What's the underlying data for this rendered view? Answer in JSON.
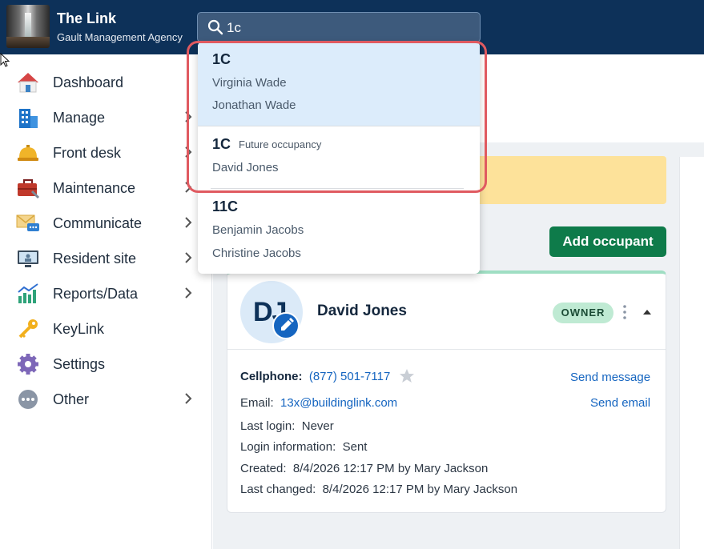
{
  "app": {
    "title": "The Link",
    "subtitle": "Gault Management Agency"
  },
  "search": {
    "value": "1c",
    "icon": "search-icon"
  },
  "sidebar": {
    "items": [
      {
        "label": "Dashboard",
        "icon": "house-icon",
        "has_chevron": false
      },
      {
        "label": "Manage",
        "icon": "building-icon",
        "has_chevron": true
      },
      {
        "label": "Front desk",
        "icon": "service-bell-icon",
        "has_chevron": true
      },
      {
        "label": "Maintenance",
        "icon": "toolbox-icon",
        "has_chevron": true
      },
      {
        "label": "Communicate",
        "icon": "envelope-chat-icon",
        "has_chevron": true
      },
      {
        "label": "Resident site",
        "icon": "monitor-icon",
        "has_chevron": true
      },
      {
        "label": "Reports/Data",
        "icon": "bar-chart-icon",
        "has_chevron": true
      },
      {
        "label": "KeyLink",
        "icon": "key-icon",
        "has_chevron": false
      },
      {
        "label": "Settings",
        "icon": "gear-icon",
        "has_chevron": false
      },
      {
        "label": "Other",
        "icon": "more-dots-icon",
        "has_chevron": true
      }
    ]
  },
  "dropdown": {
    "results": [
      {
        "unit": "1C",
        "tag": "",
        "people": [
          "Virginia Wade",
          "Jonathan Wade"
        ],
        "highlighted": true
      },
      {
        "unit": "1C",
        "tag": "Future occupancy",
        "people": [
          "David Jones"
        ],
        "highlighted": false
      },
      {
        "unit": "11C",
        "tag": "",
        "people": [
          "Benjamin Jacobs",
          "Christine Jacobs"
        ],
        "highlighted": false
      }
    ]
  },
  "main": {
    "add_occupant_label": "Add occupant"
  },
  "card": {
    "initials": "DJ",
    "name": "David Jones",
    "role_badge": "OWNER",
    "cellphone_label": "Cellphone:",
    "cellphone_value": "(877) 501-7117",
    "email_label": "Email:",
    "email_value": "13x@buildinglink.com",
    "last_login_label": "Last login:",
    "last_login_value": "Never",
    "login_info_label": "Login information:",
    "login_info_value": "Sent",
    "created_label": "Created:",
    "created_value": "8/4/2026 12:17 PM by Mary Jackson",
    "last_changed_label": "Last changed:",
    "last_changed_value": "8/4/2026 12:17 PM by Mary Jackson",
    "send_message_label": "Send message",
    "send_email_label": "Send email"
  },
  "colors": {
    "header_bg": "#0d3159",
    "primary_link": "#1565c0",
    "add_button": "#0e7b4a",
    "owner_badge": "#bfead3",
    "banner": "#fde29a",
    "highlight_ring": "#e05a60"
  }
}
